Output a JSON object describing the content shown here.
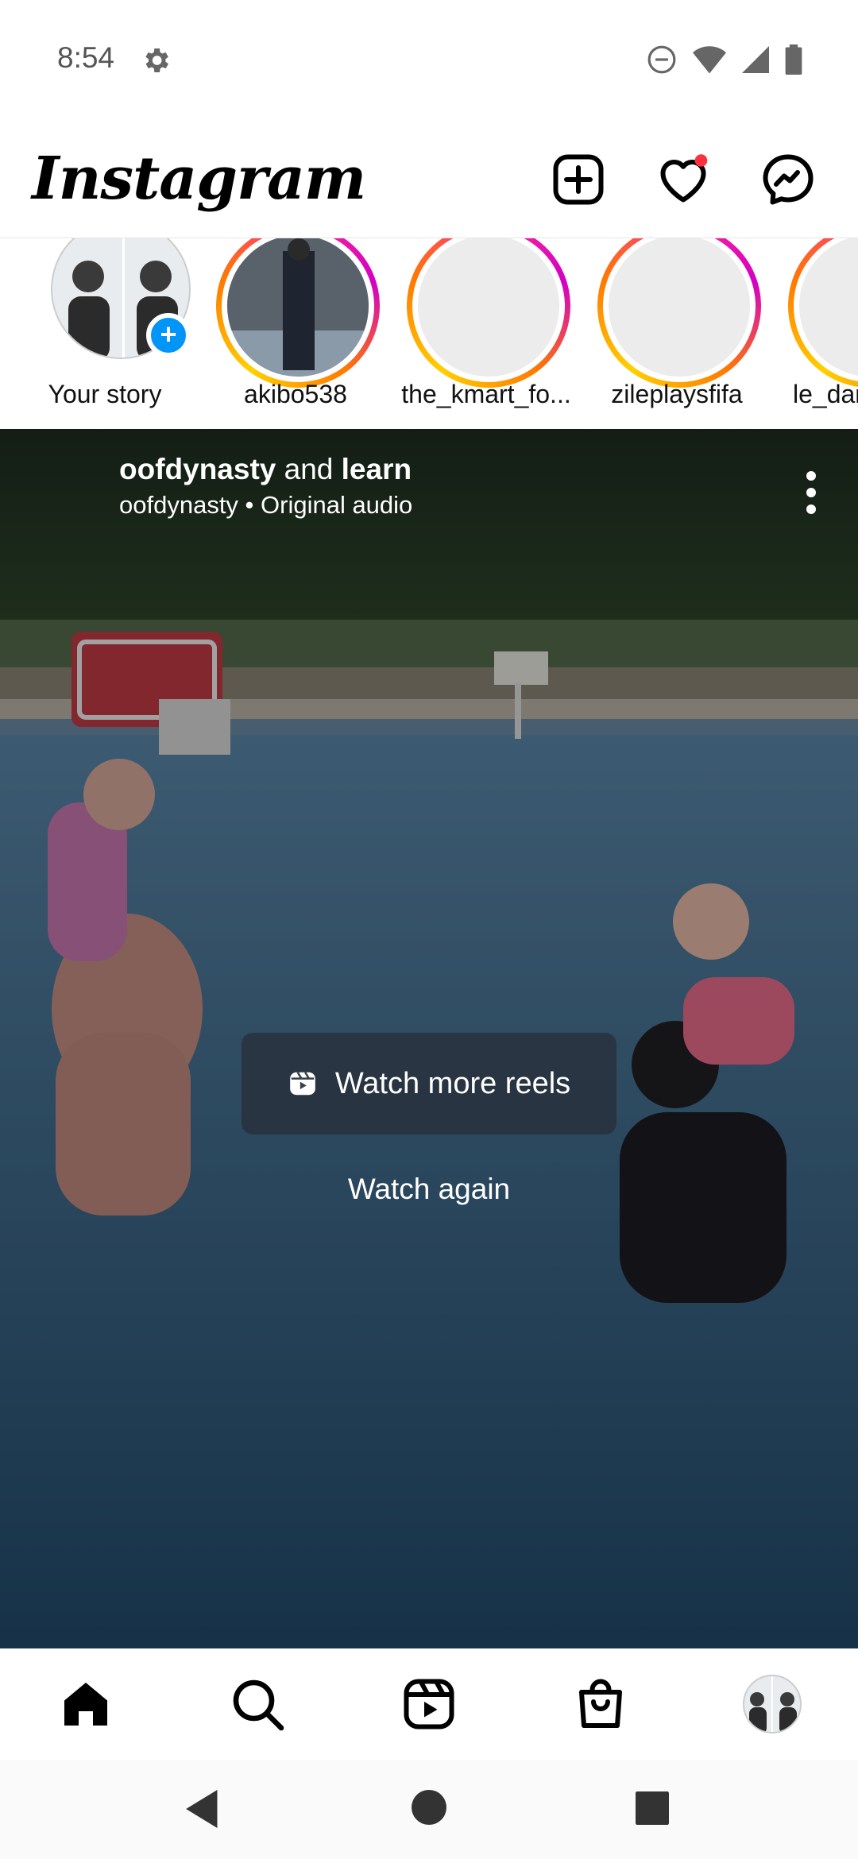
{
  "status_bar": {
    "time": "8:54",
    "icons": [
      "settings-gear-icon",
      "do-not-disturb-icon",
      "wifi-icon",
      "signal-icon",
      "battery-icon"
    ]
  },
  "app_bar": {
    "logo": "Instagram",
    "icons": [
      "new-post-icon",
      "activity-heart-icon",
      "messenger-icon"
    ],
    "notification_dot_color": "#ff3040"
  },
  "stories": [
    {
      "name": "Your story",
      "own": true
    },
    {
      "name": "akibo538"
    },
    {
      "name": "the_kmart_fo..."
    },
    {
      "name": "zileplaysfifa"
    },
    {
      "name": "le_dar"
    }
  ],
  "reel": {
    "author": "oofdynasty",
    "connector": "and",
    "collaborator": "learn",
    "subtitle": "oofdynasty • Original audio",
    "watch_more_label": "Watch more reels",
    "watch_again_label": "Watch again"
  },
  "bottom_nav": {
    "items": [
      "home-icon",
      "search-icon",
      "reels-icon",
      "shop-icon",
      "profile-avatar"
    ],
    "active": "home-icon"
  },
  "system_nav": [
    "back-icon",
    "home-circle-icon",
    "recents-square-icon"
  ],
  "colors": {
    "story_ring": "#d300c5",
    "accent": "#0095f6"
  }
}
